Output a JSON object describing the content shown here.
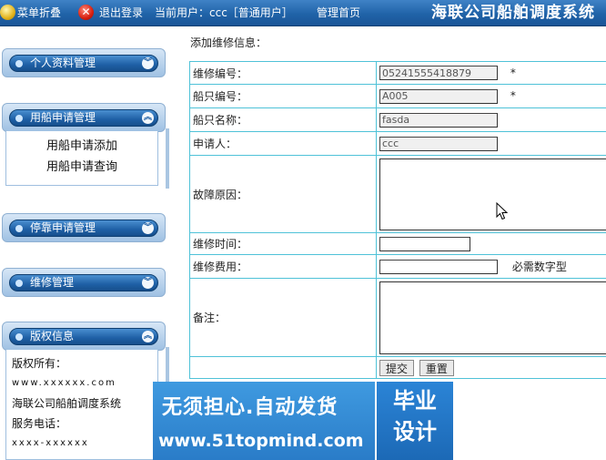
{
  "topbar": {
    "fold_label": "菜单折叠",
    "logout_label": "退出登录",
    "current_user": "当前用户：ccc［普通用户］",
    "admin_home": "管理首页",
    "system_title": "海联公司船舶调度系统"
  },
  "sidebar": {
    "panels": [
      {
        "label": "个人资料管理"
      },
      {
        "label": "用船申请管理",
        "items": [
          "用船申请添加",
          "用船申请查询"
        ]
      },
      {
        "label": "停靠申请管理"
      },
      {
        "label": "维修管理"
      },
      {
        "label": "版权信息"
      }
    ],
    "copyright": {
      "owner_label": "版权所有：",
      "website": "www.xxxxxx.com",
      "company": "海联公司船舶调度系统",
      "phone_label": "服务电话：",
      "phone": "xxxx-xxxxxx"
    }
  },
  "form": {
    "heading": "添加维修信息：",
    "fields": {
      "repair_no": {
        "label": "维修编号：",
        "value": "05241555418879",
        "required": "*"
      },
      "ship_no": {
        "label": "船只编号：",
        "value": "A005",
        "required": "*"
      },
      "ship_name": {
        "label": "船只名称：",
        "value": "fasda"
      },
      "applicant": {
        "label": "申请人：",
        "value": "ccc"
      },
      "fault_reason": {
        "label": "故障原因：",
        "value": ""
      },
      "repair_time": {
        "label": "维修时间：",
        "value": ""
      },
      "repair_cost": {
        "label": "维修费用：",
        "value": "",
        "hint": "必需数字型"
      },
      "remark": {
        "label": "备注：",
        "value": ""
      }
    },
    "submit_label": "提交",
    "reset_label": "重置"
  },
  "banner": {
    "line1": "无须担心.自动发货",
    "line2": "www.51topmind.com",
    "badge_line1": "毕业",
    "badge_line2": "设计"
  },
  "colors": {
    "header_blue": "#2063a8",
    "table_border": "#4fc2d8",
    "banner_blue": "#2a7cc8"
  }
}
